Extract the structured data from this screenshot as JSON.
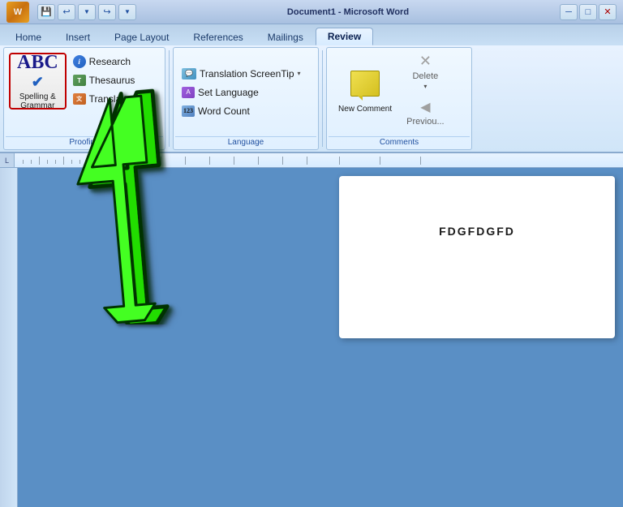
{
  "titlebar": {
    "title": "Document1 - Microsoft Word",
    "save_btn": "💾",
    "undo_btn": "↩",
    "redo_btn": "↪"
  },
  "tabs": [
    {
      "label": "Home",
      "active": false
    },
    {
      "label": "Insert",
      "active": false
    },
    {
      "label": "Page Layout",
      "active": false
    },
    {
      "label": "References",
      "active": false
    },
    {
      "label": "Mailings",
      "active": false
    },
    {
      "label": "Review",
      "active": true
    }
  ],
  "ribbon": {
    "groups": {
      "proofing": {
        "label": "Proofing",
        "spelling_label": "Spelling &\nGrammar",
        "research_label": "Research",
        "thesaurus_label": "Thesaurus",
        "translate_label": "Translate"
      },
      "language": {
        "translation_screentip_label": "Translation ScreenTip",
        "set_language_label": "Set Language",
        "word_count_label": "Word Count"
      },
      "comments": {
        "label": "Comments",
        "new_comment_label": "New\nComment",
        "delete_label": "Delete",
        "previous_label": "Previou..."
      }
    }
  },
  "document": {
    "text": "FDGFDGFD"
  },
  "cursor": {
    "visible": true
  }
}
